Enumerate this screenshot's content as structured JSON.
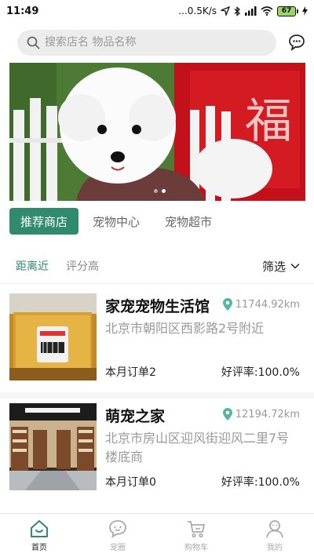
{
  "status_bar": {
    "time": "11:49",
    "network_speed": "...0.5K/s",
    "battery_level": "67"
  },
  "search": {
    "placeholder": "搜索店名 物品名称",
    "icon": "search-icon"
  },
  "header": {
    "message_icon": "chat-bubble-icon"
  },
  "banner": {
    "slides": 2,
    "active_slide": 0
  },
  "tabs": [
    {
      "label": "推荐商店",
      "active": true
    },
    {
      "label": "宠物中心",
      "active": false
    },
    {
      "label": "宠物超市",
      "active": false
    }
  ],
  "filters": {
    "sort_options": [
      {
        "label": "距离近",
        "active": true
      },
      {
        "label": "评分高",
        "active": false
      }
    ],
    "filter_label": "筛选"
  },
  "stores": [
    {
      "name": "家宠宠物生活馆",
      "distance": "11744.92km",
      "address": "北京市朝阳区西影路2号附近",
      "orders": "本月订单2",
      "rating": "好评率:100.0%"
    },
    {
      "name": "萌宠之家",
      "distance": "12194.72km",
      "address": "北京市房山区迎风街迎风二里7号楼底商",
      "orders": "本月订单0",
      "rating": "好评率:100.0%"
    }
  ],
  "bottom_nav": [
    {
      "label": "首页",
      "icon": "home-icon",
      "active": true
    },
    {
      "label": "宠圈",
      "icon": "pet-circle-icon",
      "active": false
    },
    {
      "label": "购物车",
      "icon": "cart-icon",
      "active": false
    },
    {
      "label": "我的",
      "icon": "profile-icon",
      "active": false
    }
  ],
  "colors": {
    "accent": "#2f8a6f",
    "location_pin": "#52b6a1",
    "muted_text": "#999999"
  }
}
